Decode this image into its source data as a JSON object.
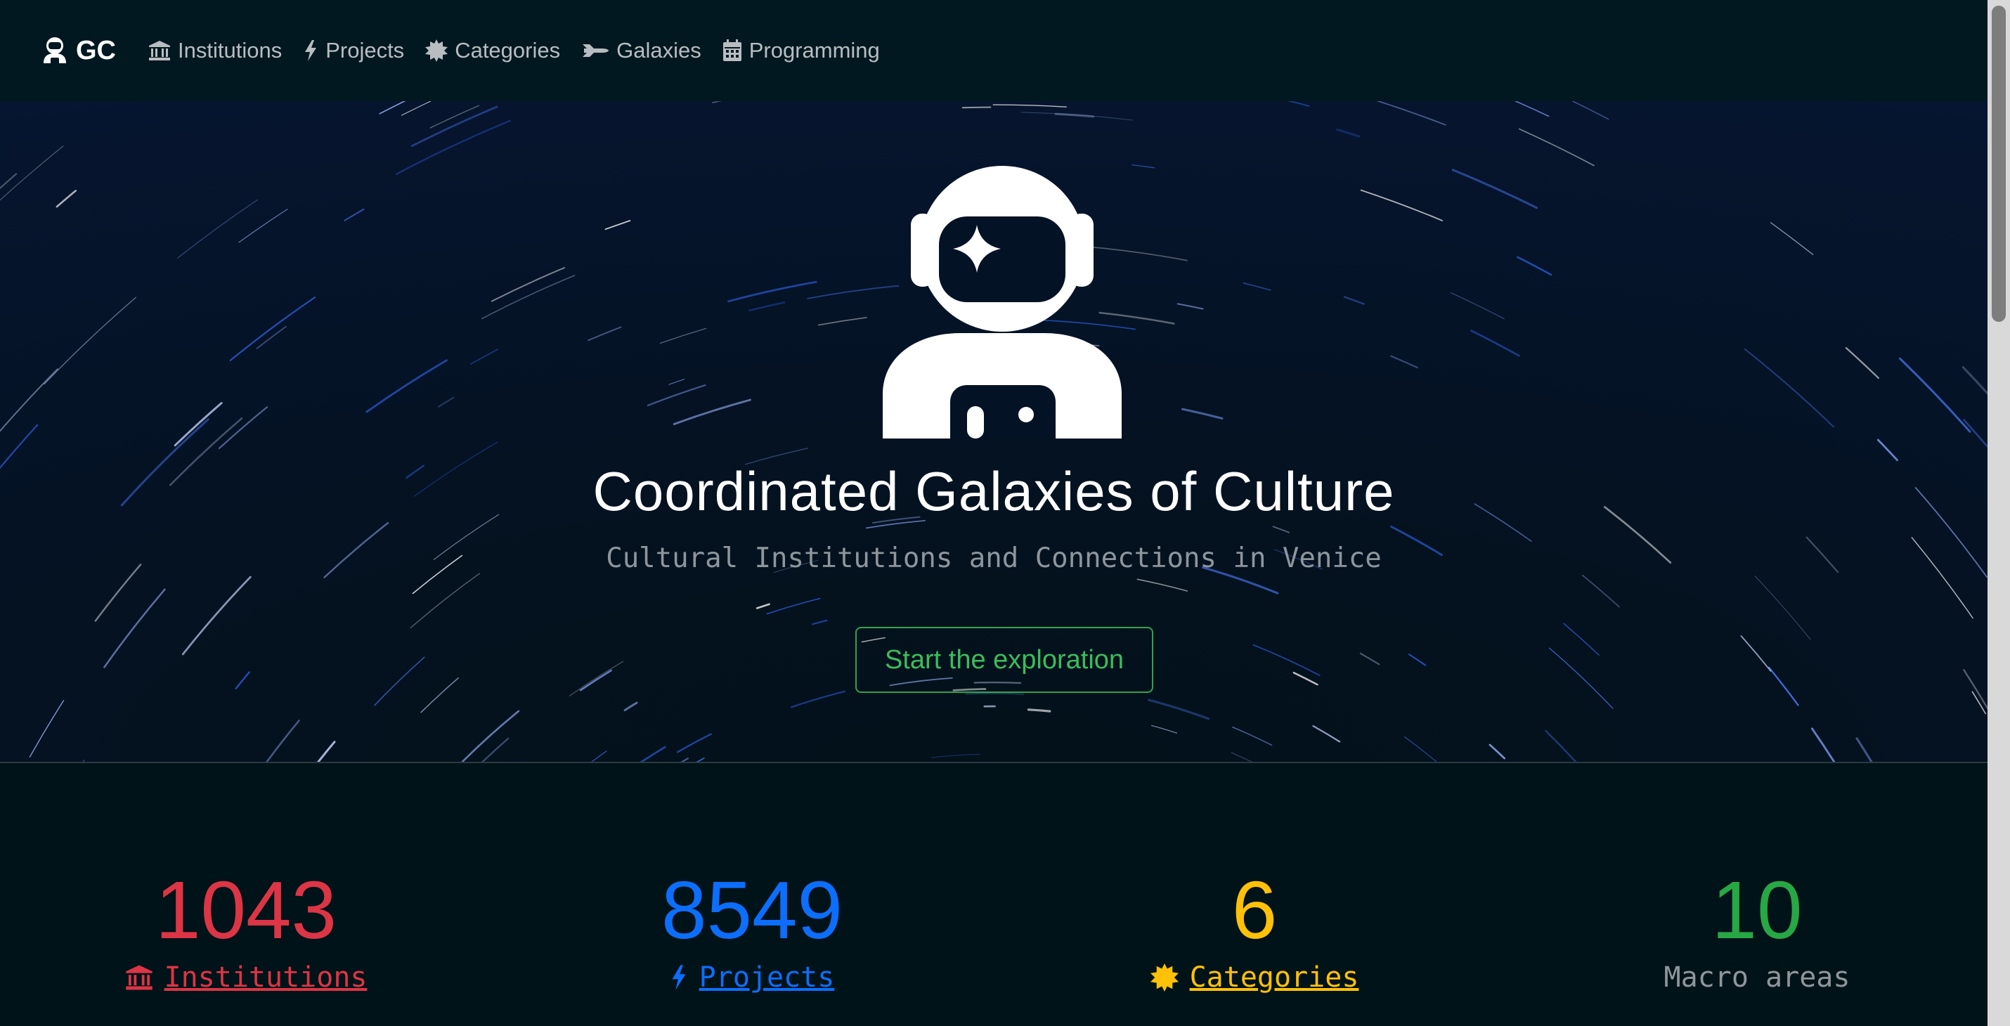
{
  "navbar": {
    "brand": "GC",
    "items": [
      {
        "label": "Institutions",
        "icon": "bank-icon"
      },
      {
        "label": "Projects",
        "icon": "bolt-icon"
      },
      {
        "label": "Categories",
        "icon": "sun-icon"
      },
      {
        "label": "Galaxies",
        "icon": "shuttle-icon"
      },
      {
        "label": "Programming",
        "icon": "calendar-icon"
      }
    ]
  },
  "hero": {
    "title": "Coordinated Galaxies of Culture",
    "subtitle": "Cultural Institutions and Connections in Venice",
    "cta_label": "Start the exploration"
  },
  "stats": [
    {
      "value": "1043",
      "label": "Institutions",
      "color": "#dc3545",
      "icon": "bank-icon"
    },
    {
      "value": "8549",
      "label": "Projects",
      "color": "#0d6efd",
      "icon": "bolt-icon"
    },
    {
      "value": "6",
      "label": "Categories",
      "color": "#ffc107",
      "icon": "sun-icon"
    },
    {
      "value": "10",
      "label": "Macro areas",
      "color": "#28a745",
      "icon": ""
    }
  ],
  "colors": {
    "background": "#001318",
    "navbar": "#011820",
    "nav_text": "#b8bdc1",
    "cta": "#3dbb5c"
  }
}
